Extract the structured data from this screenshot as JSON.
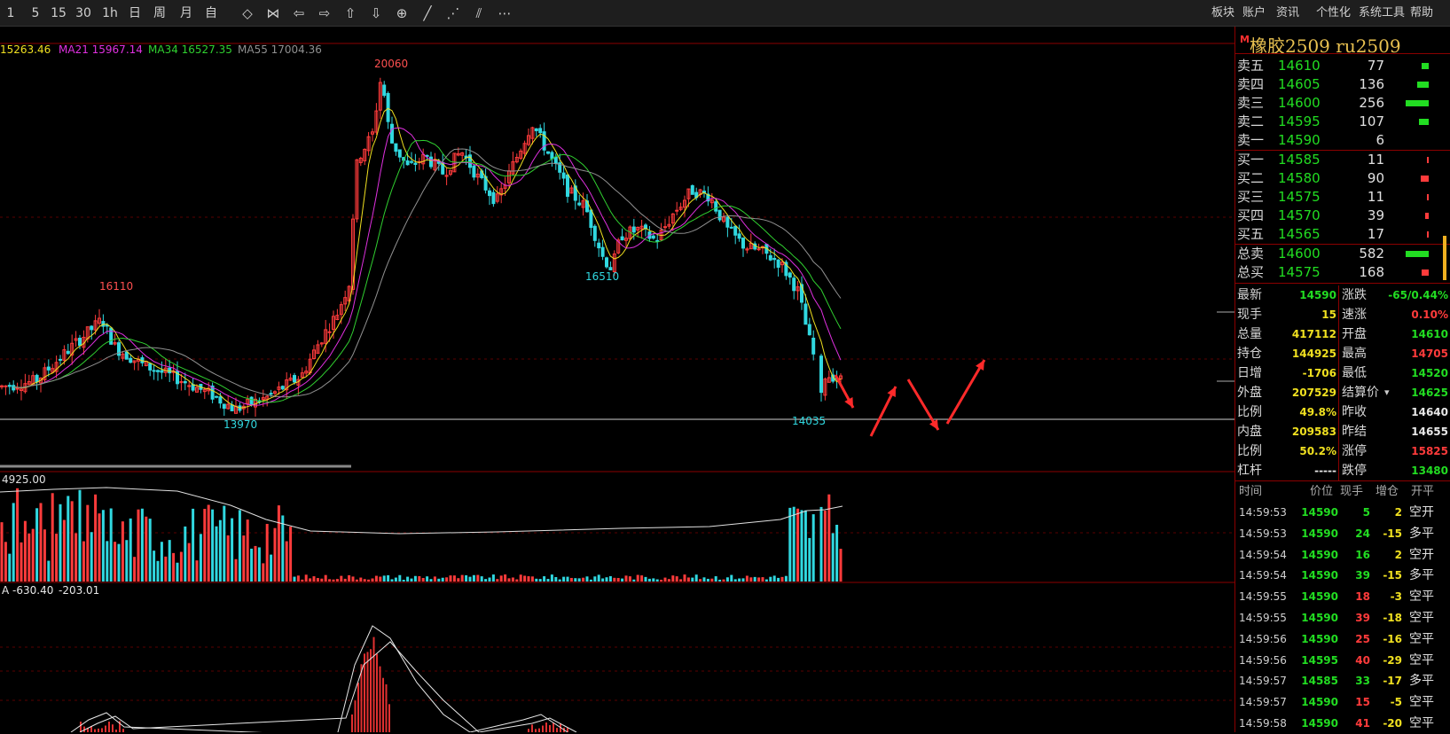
{
  "toolbar": {
    "periods": [
      "1",
      "5",
      "15",
      "30",
      "1h",
      "日",
      "周",
      "月",
      "自"
    ],
    "tool_icons": [
      "zoom-fit-icon",
      "zoom-out-icon",
      "arrow-left-icon",
      "arrow-right-icon",
      "arrow-up-icon",
      "arrow-down-icon",
      "crosshair-icon",
      "line-icon",
      "dashed-line-icon",
      "parallel-line-icon",
      "more-icon"
    ],
    "menus": [
      "板块",
      "账户",
      "资讯",
      "个性化",
      "系统工具",
      "帮助"
    ]
  },
  "main_chart": {
    "ma_legend": [
      {
        "text": "15263.46",
        "color": "#f0e020"
      },
      {
        "text": "MA21 15967.14",
        "color": "#e030e0"
      },
      {
        "text": "MA34 16527.35",
        "color": "#30d030"
      },
      {
        "text": "MA55 17004.36",
        "color": "#909090"
      }
    ],
    "annotations": [
      "20060",
      "16110",
      "16510",
      "13970",
      "14035"
    ],
    "volume_label": "4925.00",
    "macd_labels": [
      "A -630.40",
      "-203.01"
    ]
  },
  "chart_data": {
    "type": "candlestick",
    "instrument": "橡胶2509 ru2509",
    "labeled_values": {
      "high_label": 20060,
      "peak_label_1": 16110,
      "low_label_1": 13970,
      "swing_low": 16510,
      "recent_low": 14035
    },
    "ma_values": {
      "ma_first": 15263.46,
      "MA21": 15967.14,
      "MA34": 16527.35,
      "MA55": 17004.36
    },
    "volume_axis_top": 4925.0,
    "macd": {
      "first": -630.4,
      "second": -203.01
    },
    "annotation_arrows": "red zigzag down-up-down-up projection after last bar"
  },
  "quote": {
    "m_label": "M",
    "title": "橡胶2509  ru2509",
    "asks": [
      {
        "label": "卖五",
        "price": "14610",
        "vol": "77",
        "bar": 0.3
      },
      {
        "label": "卖四",
        "price": "14605",
        "vol": "136",
        "bar": 0.5
      },
      {
        "label": "卖三",
        "price": "14600",
        "vol": "256",
        "bar": 1.0
      },
      {
        "label": "卖二",
        "price": "14595",
        "vol": "107",
        "bar": 0.42
      },
      {
        "label": "卖一",
        "price": "14590",
        "vol": "6",
        "bar": 0.0
      }
    ],
    "bids": [
      {
        "label": "买一",
        "price": "14585",
        "vol": "11",
        "bar": 0.05
      },
      {
        "label": "买二",
        "price": "14580",
        "vol": "90",
        "bar": 0.35
      },
      {
        "label": "买三",
        "price": "14575",
        "vol": "11",
        "bar": 0.05
      },
      {
        "label": "买四",
        "price": "14570",
        "vol": "39",
        "bar": 0.15
      },
      {
        "label": "买五",
        "price": "14565",
        "vol": "17",
        "bar": 0.07
      }
    ],
    "totals": [
      {
        "label": "总卖",
        "price": "14600",
        "vol": "582",
        "bar": 1.0,
        "color": "#22dd22"
      },
      {
        "label": "总买",
        "price": "14575",
        "vol": "168",
        "bar": 0.3,
        "color": "#ff3b3b"
      }
    ],
    "stats": [
      {
        "l1": "最新",
        "v1": "14590",
        "c1": "green",
        "l2": "涨跌",
        "v2": "-65/0.44%",
        "c2": "green"
      },
      {
        "l1": "现手",
        "v1": "15",
        "c1": "yellow",
        "l2": "速涨",
        "v2": "0.10%",
        "c2": "red"
      },
      {
        "l1": "总量",
        "v1": "417112",
        "c1": "yellow",
        "l2": "开盘",
        "v2": "14610",
        "c2": "green"
      },
      {
        "l1": "持仓",
        "v1": "144925",
        "c1": "yellow",
        "l2": "最高",
        "v2": "14705",
        "c2": "red"
      },
      {
        "l1": "日增",
        "v1": "-1706",
        "c1": "yellow",
        "l2": "最低",
        "v2": "14520",
        "c2": "green"
      },
      {
        "l1": "外盘",
        "v1": "207529",
        "c1": "yellow",
        "l2": "结算价",
        "v2": "14625",
        "c2": "green"
      },
      {
        "l1": "比例",
        "v1": "49.8%",
        "c1": "yellow",
        "l2": "昨收",
        "v2": "14640",
        "c2": "white"
      },
      {
        "l1": "内盘",
        "v1": "209583",
        "c1": "yellow",
        "l2": "昨结",
        "v2": "14655",
        "c2": "white"
      },
      {
        "l1": "比例",
        "v1": "50.2%",
        "c1": "yellow",
        "l2": "涨停",
        "v2": "15825",
        "c2": "red"
      },
      {
        "l1": "杠杆",
        "v1": "-----",
        "c1": "white",
        "l2": "跌停",
        "v2": "13480",
        "c2": "green"
      }
    ],
    "tick_header": [
      "时间",
      "价位",
      "现手",
      "增仓",
      "开平"
    ],
    "ticks": [
      {
        "time": "14:59:53",
        "price": "14590",
        "hand": "5",
        "chg": "2",
        "type": "空开",
        "hc": "green",
        "cc": "yellow"
      },
      {
        "time": "14:59:53",
        "price": "14590",
        "hand": "24",
        "chg": "-15",
        "type": "多平",
        "hc": "green",
        "cc": "yellow"
      },
      {
        "time": "14:59:54",
        "price": "14590",
        "hand": "16",
        "chg": "2",
        "type": "空开",
        "hc": "green",
        "cc": "yellow"
      },
      {
        "time": "14:59:54",
        "price": "14590",
        "hand": "39",
        "chg": "-15",
        "type": "多平",
        "hc": "green",
        "cc": "yellow"
      },
      {
        "time": "14:59:55",
        "price": "14590",
        "hand": "18",
        "chg": "-3",
        "type": "空平",
        "hc": "red",
        "cc": "yellow"
      },
      {
        "time": "14:59:55",
        "price": "14590",
        "hand": "39",
        "chg": "-18",
        "type": "空平",
        "hc": "red",
        "cc": "yellow"
      },
      {
        "time": "14:59:56",
        "price": "14590",
        "hand": "25",
        "chg": "-16",
        "type": "空平",
        "hc": "red",
        "cc": "yellow"
      },
      {
        "time": "14:59:56",
        "price": "14595",
        "hand": "40",
        "chg": "-29",
        "type": "空平",
        "hc": "red",
        "cc": "yellow"
      },
      {
        "time": "14:59:57",
        "price": "14585",
        "hand": "33",
        "chg": "-17",
        "type": "多平",
        "hc": "green",
        "cc": "yellow"
      },
      {
        "time": "14:59:57",
        "price": "14590",
        "hand": "15",
        "chg": "-5",
        "type": "空平",
        "hc": "red",
        "cc": "yellow"
      },
      {
        "time": "14:59:58",
        "price": "14590",
        "hand": "41",
        "chg": "-20",
        "type": "空平",
        "hc": "red",
        "cc": "yellow"
      }
    ]
  },
  "colors": {
    "up": "#ff3b3b",
    "down": "#30d8e0",
    "grid": "#8b0000",
    "accent": "#f0b020"
  }
}
